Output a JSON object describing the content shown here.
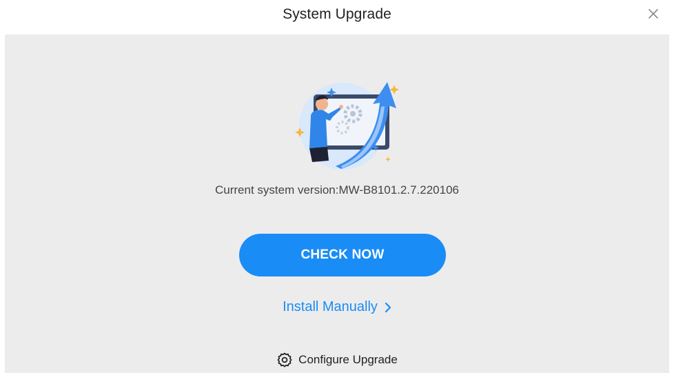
{
  "dialog": {
    "title": "System Upgrade",
    "close_icon": "close-icon"
  },
  "main": {
    "illustration": "upgrade-illustration",
    "version_text": "Current system version:MW-B8101.2.7.220106",
    "check_button_label": "CHECK NOW",
    "install_manually_label": "Install Manually",
    "install_manually_icon": "chevron-right-icon",
    "configure_label": "Configure Upgrade",
    "configure_icon": "gear-icon"
  },
  "colors": {
    "accent": "#1a8cf5",
    "panel_bg": "#ececec",
    "text_primary": "#222222",
    "text_secondary": "#444444"
  }
}
